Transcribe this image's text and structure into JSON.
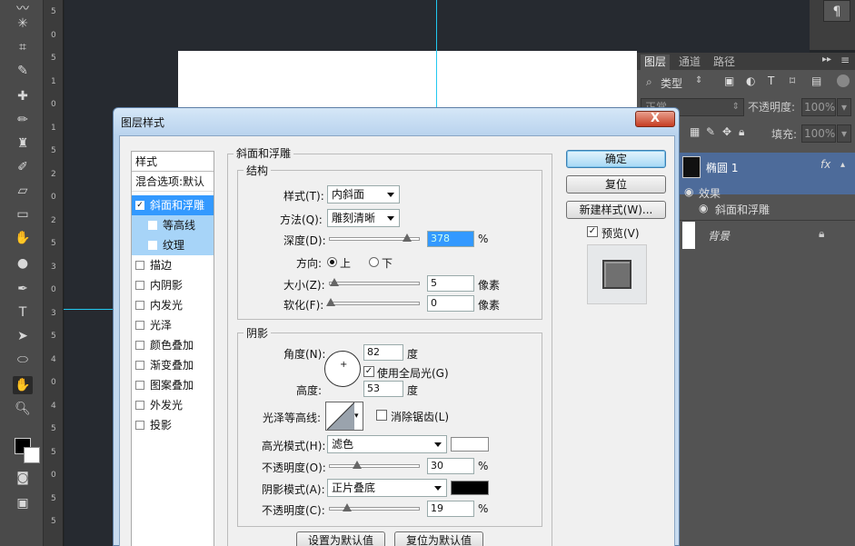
{
  "rulers": {
    "vertical_marks": [
      "5",
      "0",
      "5",
      "1",
      "0",
      "1",
      "5",
      "2",
      "0",
      "2",
      "5",
      "3",
      "0",
      "3",
      "5",
      "4",
      "0",
      "4",
      "5",
      "5",
      "0",
      "5",
      "5"
    ]
  },
  "photoshop": {
    "paragraph_icon": "¶"
  },
  "layers_panel": {
    "tabs": [
      "图层",
      "通道",
      "路径"
    ],
    "filter_kind": "类型",
    "blend_mode": "正常",
    "opacity_label": "不透明度:",
    "opacity_value": "100%",
    "fill_label": "填充:",
    "fill_value": "100%",
    "layers": [
      {
        "name": "椭圆 1",
        "fx": "fx"
      },
      {
        "name": "效果"
      },
      {
        "name": "斜面和浮雕"
      },
      {
        "name": "背景"
      }
    ]
  },
  "dialog": {
    "title": "图层样式",
    "close": "X",
    "styles_header": "样式",
    "blend_options": "混合选项:默认",
    "styles": [
      {
        "label": "斜面和浮雕",
        "checked": true
      },
      {
        "label": "等高线",
        "checked": false
      },
      {
        "label": "纹理",
        "checked": false
      },
      {
        "label": "描边",
        "checked": false
      },
      {
        "label": "内阴影",
        "checked": false
      },
      {
        "label": "内发光",
        "checked": false
      },
      {
        "label": "光泽",
        "checked": false
      },
      {
        "label": "颜色叠加",
        "checked": false
      },
      {
        "label": "渐变叠加",
        "checked": false
      },
      {
        "label": "图案叠加",
        "checked": false
      },
      {
        "label": "外发光",
        "checked": false
      },
      {
        "label": "投影",
        "checked": false
      }
    ],
    "section_title": "斜面和浮雕",
    "structure": {
      "title": "结构",
      "style_label": "样式(T):",
      "style_value": "内斜面",
      "technique_label": "方法(Q):",
      "technique_value": "雕刻清晰",
      "depth_label": "深度(D):",
      "depth_value": "378",
      "depth_unit": "%",
      "depth_level": 0.85,
      "direction_label": "方向:",
      "dir_up": "上",
      "dir_down": "下",
      "size_label": "大小(Z):",
      "size_value": "5",
      "size_unit": "像素",
      "soften_label": "软化(F):",
      "soften_value": "0",
      "soften_unit": "像素"
    },
    "shading": {
      "title": "阴影",
      "angle_label": "角度(N):",
      "angle_value": "82",
      "angle_unit": "度",
      "global_light": "使用全局光(G)",
      "altitude_label": "高度:",
      "altitude_value": "53",
      "altitude_unit": "度",
      "gloss_label": "光泽等高线:",
      "antialias": "消除锯齿(L)",
      "highlight_label": "高光模式(H):",
      "highlight_value": "滤色",
      "hl_opacity_label": "不透明度(O):",
      "hl_opacity_value": "30",
      "hl_unit": "%",
      "shadow_label": "阴影模式(A):",
      "shadow_value": "正片叠底",
      "sh_opacity_label": "不透明度(C):",
      "sh_opacity_value": "19",
      "sh_unit": "%",
      "highlight_color": "#ffffff",
      "shadow_color": "#000000"
    },
    "buttons": {
      "ok": "确定",
      "reset": "复位",
      "new_style": "新建样式(W)...",
      "preview": "预览(V)",
      "make_default": "设置为默认值",
      "reset_default": "复位为默认值"
    }
  }
}
